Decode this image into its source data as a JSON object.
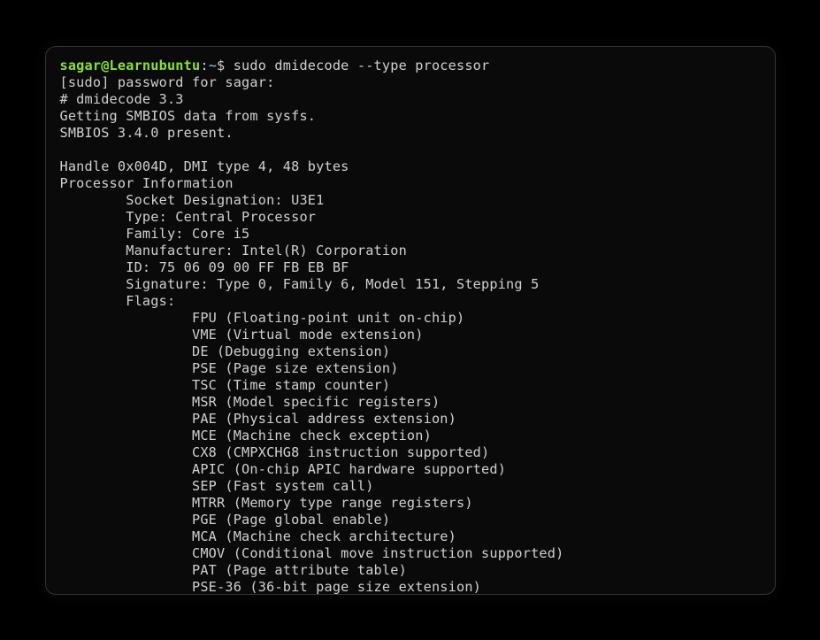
{
  "prompt": {
    "user_host": "sagar@Learnubuntu",
    "colon": ":",
    "path": "~",
    "symbol": "$ "
  },
  "command": "sudo dmidecode --type processor",
  "output": {
    "sudo_prompt": "[sudo] password for sagar:",
    "header1": "# dmidecode 3.3",
    "header2": "Getting SMBIOS data from sysfs.",
    "header3": "SMBIOS 3.4.0 present.",
    "blank1": "",
    "handle": "Handle 0x004D, DMI type 4, 48 bytes",
    "section": "Processor Information",
    "socket": "        Socket Designation: U3E1",
    "type": "        Type: Central Processor",
    "family": "        Family: Core i5",
    "manufacturer": "        Manufacturer: Intel(R) Corporation",
    "id": "        ID: 75 06 09 00 FF FB EB BF",
    "signature": "        Signature: Type 0, Family 6, Model 151, Stepping 5",
    "flags_label": "        Flags:",
    "flags": [
      "                FPU (Floating-point unit on-chip)",
      "                VME (Virtual mode extension)",
      "                DE (Debugging extension)",
      "                PSE (Page size extension)",
      "                TSC (Time stamp counter)",
      "                MSR (Model specific registers)",
      "                PAE (Physical address extension)",
      "                MCE (Machine check exception)",
      "                CX8 (CMPXCHG8 instruction supported)",
      "                APIC (On-chip APIC hardware supported)",
      "                SEP (Fast system call)",
      "                MTRR (Memory type range registers)",
      "                PGE (Page global enable)",
      "                MCA (Machine check architecture)",
      "                CMOV (Conditional move instruction supported)",
      "                PAT (Page attribute table)",
      "                PSE-36 (36-bit page size extension)"
    ]
  }
}
